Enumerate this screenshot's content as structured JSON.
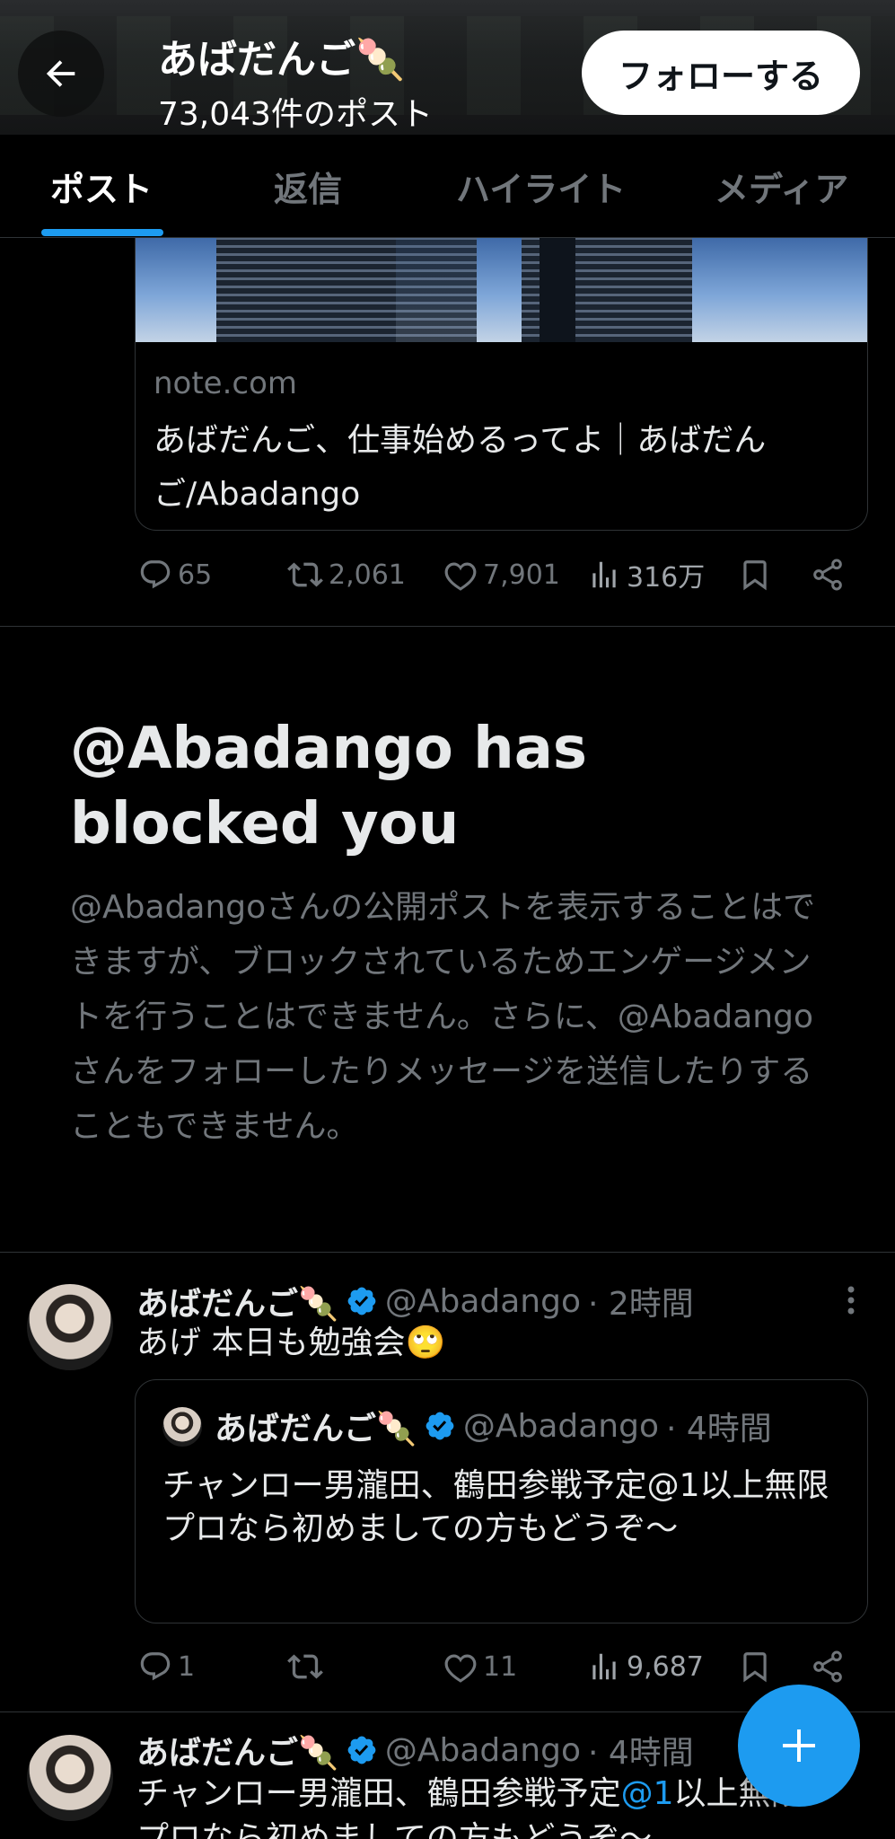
{
  "header": {
    "name": "あばだんご",
    "post_count": "73,043件のポスト",
    "follow_label": "フォローする"
  },
  "tabs": [
    {
      "label": "ポスト",
      "active": true
    },
    {
      "label": "返信",
      "active": false
    },
    {
      "label": "ハイライト",
      "active": false
    },
    {
      "label": "メディア",
      "active": false
    }
  ],
  "link_card": {
    "domain": "note.com",
    "title": "あばだんご、仕事始めるってよ｜あばだんご/Abadango"
  },
  "post1_actions": {
    "replies": "65",
    "reposts": "2,061",
    "likes": "7,901",
    "views": "316万"
  },
  "blocked": {
    "title": "@Abadango has blocked you",
    "text": "@Abadangoさんの公開ポストを表示することはできますが、ブロックされているためエンゲージメントを行うことはできません。さらに、@Abadangoさんをフォローしたりメッセージを送信したりすることもできません。"
  },
  "tweet1": {
    "name": "あばだんご",
    "handle": "@Abadango",
    "time": "· 2時間",
    "text": "あげ 本日も勉強会🙄",
    "quote": {
      "name": "あばだんご",
      "handle": "@Abadango",
      "time": "· 4時間",
      "text": "チャンロー男瀧田、鶴田参戦予定@1以上無限\nプロなら初めましての方もどうぞ〜"
    },
    "actions": {
      "replies": "1",
      "reposts": "",
      "likes": "11",
      "views": "9,687"
    }
  },
  "tweet2": {
    "name": "あばだんご",
    "handle": "@Abadango",
    "time": "· 4時間",
    "text_before": "チャンロー男瀧田、鶴田参戦予定",
    "mention": "@1",
    "text_after": "以上無限",
    "text2": "プロなら初めましての方もどうぞ〜"
  },
  "emoji": {
    "dango": "🍡"
  },
  "colors": {
    "accent": "#1d9bf0",
    "background": "#000000",
    "secondary_text": "#71767b"
  }
}
